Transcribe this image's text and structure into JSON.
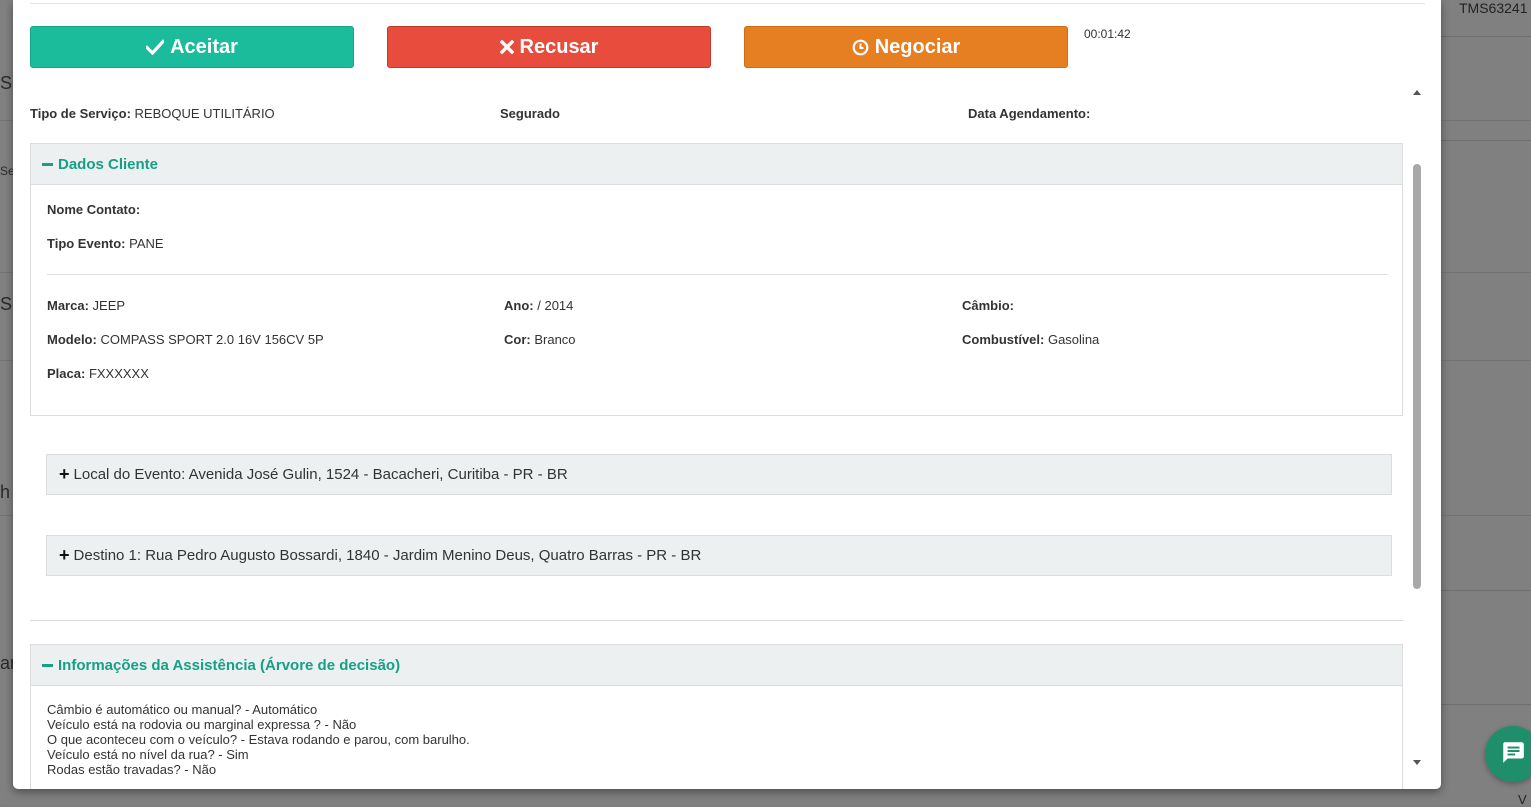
{
  "background": {
    "top_right_text": "TMS63241",
    "left_fragments": [
      "S",
      "Se",
      "S",
      "h",
      "ar"
    ],
    "bottom_right_text": "V"
  },
  "actions": {
    "accept_label": "Aceitar",
    "reject_label": "Recusar",
    "negotiate_label": "Negociar",
    "timer": "00:01:42"
  },
  "service": {
    "type_label": "Tipo de Serviço:",
    "type_value": "REBOQUE UTILITÁRIO",
    "insured_label": "Segurado",
    "schedule_label": "Data Agendamento:",
    "schedule_value": ""
  },
  "client": {
    "title": "Dados Cliente",
    "contact_label": "Nome Contato:",
    "contact_value": "",
    "event_type_label": "Tipo Evento:",
    "event_type_value": "PANE",
    "brand_label": "Marca:",
    "brand_value": "JEEP",
    "model_label": "Modelo:",
    "model_value": "COMPASS SPORT 2.0 16V 156CV 5P",
    "plate_label": "Placa:",
    "plate_value": "FXXXXXX",
    "year_label": "Ano:",
    "year_value": "/ 2014",
    "color_label": "Cor:",
    "color_value": "Branco",
    "gearbox_label": "Câmbio:",
    "gearbox_value": "",
    "fuel_label": "Combustível:",
    "fuel_value": "Gasolina"
  },
  "locations": {
    "event": "Local do Evento: Avenida José Gulin, 1524 - Bacacheri, Curitiba - PR - BR",
    "destination": "Destino 1: Rua Pedro Augusto Bossardi, 1840 - Jardim Menino Deus, Quatro Barras - PR - BR"
  },
  "assistance": {
    "title": "Informações da Assistência (Árvore de decisão)",
    "lines": [
      "Câmbio é automático ou manual? - Automático",
      "Veículo está na rodovia ou marginal expressa ? - Não",
      "O que aconteceu com o veículo? - Estava rodando e parou, com barulho.",
      "Veículo está no nível da rua? - Sim",
      "Rodas estão travadas? - Não"
    ]
  },
  "icons": {
    "accept": "check-icon",
    "reject": "times-icon",
    "negotiate": "clock-icon",
    "chat": "chat-icon"
  },
  "colors": {
    "accept": "#1abc9c",
    "reject": "#e74c3c",
    "negotiate": "#e67e22",
    "panel_title": "#16a085",
    "chat": "#1f8f6b"
  }
}
